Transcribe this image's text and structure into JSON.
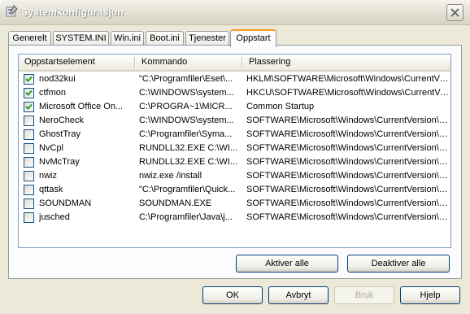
{
  "window": {
    "title": "Systemkonfigurasjon"
  },
  "tabs": [
    {
      "label": "Generelt"
    },
    {
      "label": "SYSTEM.INI"
    },
    {
      "label": "Win.ini"
    },
    {
      "label": "Boot.ini"
    },
    {
      "label": "Tjenester"
    },
    {
      "label": "Oppstart",
      "active": true
    }
  ],
  "columns": [
    "Oppstartselement",
    "Kommando",
    "Plassering"
  ],
  "rows": [
    {
      "checked": true,
      "item": "nod32kui",
      "command": "\"C:\\Programfiler\\Eset\\...",
      "location": "HKLM\\SOFTWARE\\Microsoft\\Windows\\CurrentVer..."
    },
    {
      "checked": true,
      "item": "ctfmon",
      "command": "C:\\WINDOWS\\system...",
      "location": "HKCU\\SOFTWARE\\Microsoft\\Windows\\CurrentVer..."
    },
    {
      "checked": true,
      "item": "Microsoft Office On...",
      "command": "C:\\PROGRA~1\\MICR...",
      "location": "Common Startup"
    },
    {
      "checked": false,
      "item": "NeroCheck",
      "command": "C:\\WINDOWS\\system...",
      "location": "SOFTWARE\\Microsoft\\Windows\\CurrentVersion\\Run"
    },
    {
      "checked": false,
      "item": "GhostTray",
      "command": "C:\\Programfiler\\Syma...",
      "location": "SOFTWARE\\Microsoft\\Windows\\CurrentVersion\\Run"
    },
    {
      "checked": false,
      "item": "NvCpl",
      "command": "RUNDLL32.EXE C:\\WI...",
      "location": "SOFTWARE\\Microsoft\\Windows\\CurrentVersion\\Run"
    },
    {
      "checked": false,
      "item": "NvMcTray",
      "command": "RUNDLL32.EXE C:\\WI...",
      "location": "SOFTWARE\\Microsoft\\Windows\\CurrentVersion\\Run"
    },
    {
      "checked": false,
      "item": "nwiz",
      "command": "nwiz.exe /install",
      "location": "SOFTWARE\\Microsoft\\Windows\\CurrentVersion\\Run"
    },
    {
      "checked": false,
      "item": "qttask",
      "command": "\"C:\\Programfiler\\Quick...",
      "location": "SOFTWARE\\Microsoft\\Windows\\CurrentVersion\\Run"
    },
    {
      "checked": false,
      "item": "SOUNDMAN",
      "command": "SOUNDMAN.EXE",
      "location": "SOFTWARE\\Microsoft\\Windows\\CurrentVersion\\Run"
    },
    {
      "checked": false,
      "item": "jusched",
      "command": "C:\\Programfiler\\Java\\j...",
      "location": "SOFTWARE\\Microsoft\\Windows\\CurrentVersion\\Run"
    }
  ],
  "panel_buttons": {
    "enable_all": "Aktiver alle",
    "disable_all": "Deaktiver alle"
  },
  "dialog_buttons": {
    "ok": "OK",
    "cancel": "Avbryt",
    "apply": "Bruk",
    "help": "Hjelp"
  },
  "icons": {
    "app": "system-config-icon",
    "close": "close-icon",
    "check": "checkmark-icon"
  },
  "colors": {
    "active_tab_accent": "#ff9c26",
    "check_green": "#21a121",
    "listview_border": "#7f9db9"
  }
}
